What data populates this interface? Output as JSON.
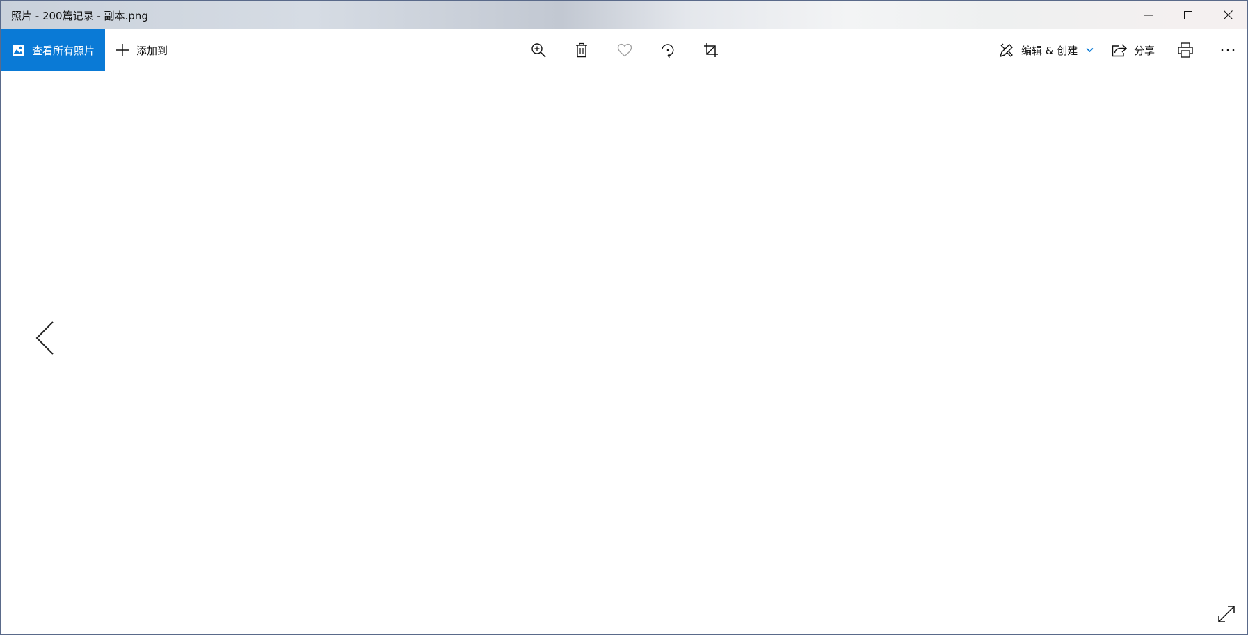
{
  "window": {
    "title": "照片 - 200篇记录 - 副本.png"
  },
  "toolbar": {
    "view_all_label": "查看所有照片",
    "add_to_label": "添加到",
    "edit_create_label": "编辑 & 创建",
    "share_label": "分享"
  },
  "colors": {
    "accent": "#0a7ad6",
    "favorite_disabled": "#a0a0a0"
  },
  "icons": {
    "view_all": "photo-icon",
    "add_to": "plus-icon",
    "zoom": "zoom-in-icon",
    "delete": "trash-icon",
    "favorite": "heart-icon",
    "rotate": "rotate-icon",
    "crop": "crop-icon",
    "edit_create": "edit-create-icon",
    "share": "share-icon",
    "print": "print-icon",
    "more": "more-icon",
    "prev": "chevron-left-icon",
    "fullscreen": "expand-icon"
  }
}
